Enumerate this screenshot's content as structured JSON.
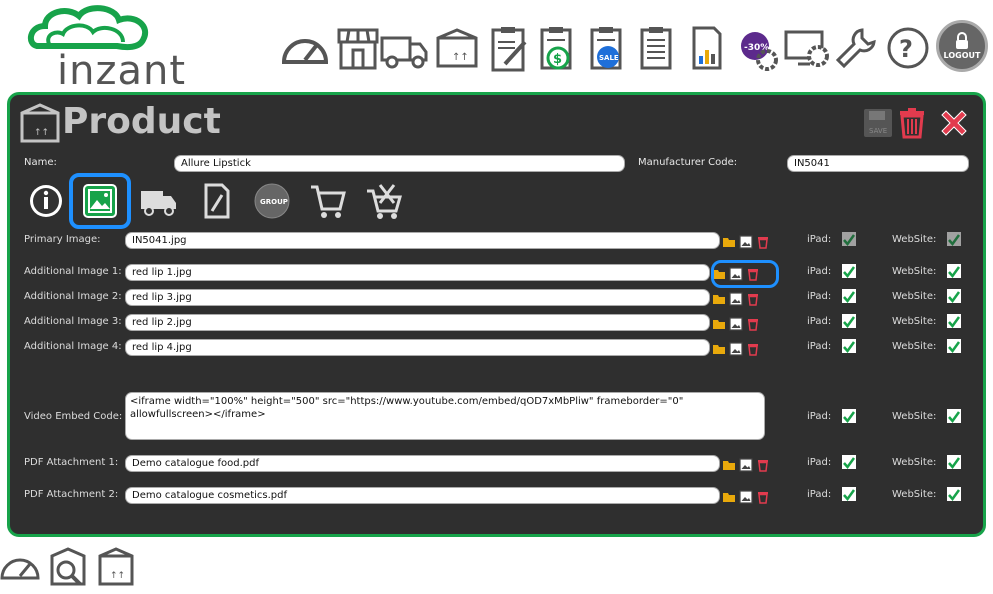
{
  "brand": {
    "name": "inzant",
    "color": "#17a34a"
  },
  "nav": {
    "icons": [
      "dashboard-gauge-icon",
      "store-icon",
      "delivery-truck-icon",
      "product-box-icon",
      "clipboard-edit-icon",
      "price-clipboard-icon",
      "sale-clipboard-icon",
      "list-clipboard-icon",
      "report-chart-icon",
      "discount-gear-icon",
      "settings-monitor-icon",
      "tools-wrench-icon",
      "help-icon"
    ],
    "discount_badge": "-30%",
    "sale_badge": "SALE",
    "logout_label": "LOGOUT"
  },
  "page": {
    "title": "Product",
    "save_icon_text": "SAVE",
    "name_label": "Name:",
    "name_value": "Allure Lipstick",
    "manufacturer_label": "Manufacturer Code:",
    "manufacturer_value": "IN5041",
    "group_tab_label": "GROUP"
  },
  "tabs": [
    "info-tab",
    "images-tab",
    "delivery-tab",
    "documents-tab",
    "group-tab",
    "cart-tab",
    "tools-cart-tab"
  ],
  "ipad_label": "iPad:",
  "website_label": "WebSite:",
  "rows": [
    {
      "label": "Primary Image:",
      "value": "IN5041.jpg",
      "ipad": true,
      "website": true,
      "faded": true
    },
    {
      "label": "Additional Image 1:",
      "value": "red lip 1.jpg",
      "ipad": true,
      "website": true
    },
    {
      "label": "Additional Image 2:",
      "value": "red lip 3.jpg",
      "ipad": true,
      "website": true
    },
    {
      "label": "Additional Image 3:",
      "value": "red lip 2.jpg",
      "ipad": true,
      "website": true
    },
    {
      "label": "Additional Image 4:",
      "value": "red lip 4.jpg",
      "ipad": true,
      "website": true
    }
  ],
  "video": {
    "label": "Video Embed Code:",
    "value": "<iframe width=\"100%\" height=\"500\" src=\"https://www.youtube.com/embed/qOD7xMbPliw\" frameborder=\"0\" allowfullscreen></iframe>"
  },
  "pdfs": [
    {
      "label": "PDF Attachment 1:",
      "value": "Demo catalogue food.pdf"
    },
    {
      "label": "PDF Attachment 2:",
      "value": "Demo catalogue cosmetics.pdf"
    }
  ],
  "footer_icons": [
    "dashboard-gauge-icon",
    "search-product-icon",
    "product-box-icon"
  ]
}
